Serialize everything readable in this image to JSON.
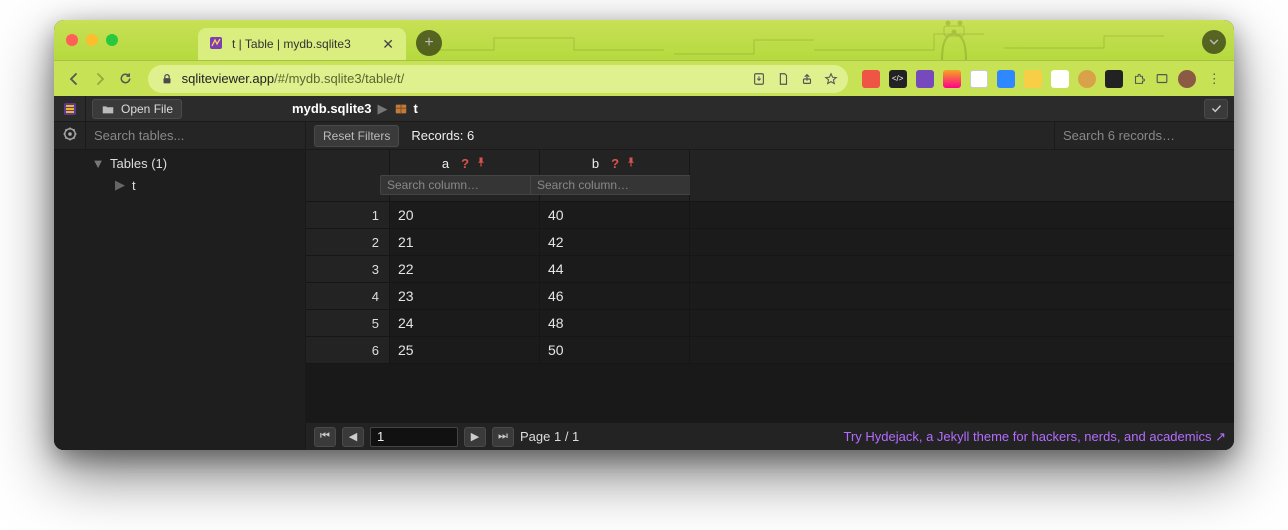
{
  "browser": {
    "tab_title": "t | Table | mydb.sqlite3",
    "url_host": "sqliteviewer.app",
    "url_path": "/#/mydb.sqlite3/table/t/"
  },
  "app": {
    "open_file_label": "Open File",
    "breadcrumb_db": "mydb.sqlite3",
    "breadcrumb_table": "t",
    "sidebar": {
      "search_placeholder": "Search tables...",
      "group_label": "Tables (1)",
      "items": [
        {
          "label": "t"
        }
      ]
    },
    "toolbar": {
      "reset_filters_label": "Reset Filters",
      "records_label": "Records: 6",
      "search_records_placeholder": "Search 6 records…"
    },
    "table": {
      "columns": [
        {
          "name": "a",
          "search_placeholder": "Search column…"
        },
        {
          "name": "b",
          "search_placeholder": "Search column…"
        }
      ],
      "rows": [
        {
          "n": "1",
          "a": "20",
          "b": "40"
        },
        {
          "n": "2",
          "a": "21",
          "b": "42"
        },
        {
          "n": "3",
          "a": "22",
          "b": "44"
        },
        {
          "n": "4",
          "a": "23",
          "b": "46"
        },
        {
          "n": "5",
          "a": "24",
          "b": "48"
        },
        {
          "n": "6",
          "a": "25",
          "b": "50"
        }
      ]
    },
    "pager": {
      "current_page_value": "1",
      "page_label": "Page 1 / 1"
    },
    "promo_text": "Try Hydejack, a Jekyll theme for hackers, nerds, and academics ↗"
  },
  "colors": {
    "chrome_green": "#c7e254",
    "tab_green": "#d9ee7e",
    "danger": "#d9534f",
    "promo_purple": "#b46cff"
  }
}
